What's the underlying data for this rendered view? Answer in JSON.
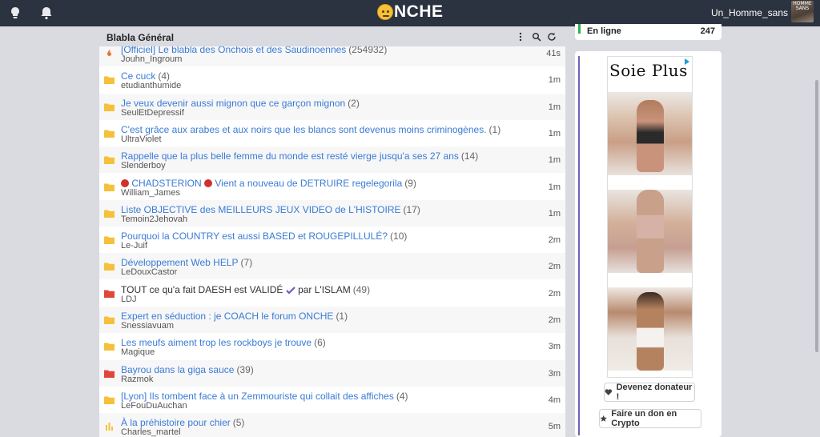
{
  "header": {
    "logo_text": "NCHE",
    "username": "Un_Homme_sans",
    "avatar_caption": "HOMME SANS",
    "icons": [
      "lightbulb-icon",
      "bell-icon"
    ]
  },
  "forum": {
    "title": "Blabla Général",
    "icons": [
      "more-vertical-icon",
      "search-icon",
      "refresh-icon"
    ]
  },
  "topics": [
    {
      "icon": "fire",
      "title": "[Officiel] Le blabla des Onchois et des Saudinoennes",
      "count": "(254932)",
      "author": "Jouhn_Ingroum",
      "time": "41s"
    },
    {
      "icon": "folder",
      "title": "Ce cuck",
      "count": "(4)",
      "author": "etudianthumide",
      "time": "1m"
    },
    {
      "icon": "folder",
      "title": "Je veux devenir aussi mignon que ce garçon mignon",
      "count": "(2)",
      "author": "SeulEtDepressif",
      "time": "1m"
    },
    {
      "icon": "folder",
      "title": "C'est grâce aux arabes et aux noirs que les blancs sont devenus moins criminogènes.",
      "count": "(1)",
      "author": "UltraViolet",
      "time": "1m"
    },
    {
      "icon": "folder",
      "title": "Rappelle que la plus belle femme du monde est resté vierge jusqu'a ses 27 ans",
      "count": "(14)",
      "author": "Slenderboy",
      "time": "1m"
    },
    {
      "icon": "folder",
      "title_prefix": "CHADSTERION",
      "title": "Vient a nouveau de DETRUIRE regelegorila",
      "count": "(9)",
      "author": "William_James",
      "time": "1m"
    },
    {
      "icon": "folder",
      "title": "Liste OBJECTIVE des MEILLEURS JEUX VIDEO de L'HISTOIRE",
      "count": "(17)",
      "author": "Temoin2Jehovah",
      "time": "1m"
    },
    {
      "icon": "folder",
      "title": "Pourquoi la COUNTRY est aussi BASED et ROUGEPILLULÉ?",
      "count": "(10)",
      "author": "Le-Juif",
      "time": "2m"
    },
    {
      "icon": "folder",
      "title": "Développement Web HELP",
      "count": "(7)",
      "author": "LeDouxCastor",
      "time": "2m"
    },
    {
      "icon": "folder-red",
      "title_prefix": "TOUT ce qu'a fait DAESH est VALIDÉ",
      "title": "par L'ISLAM",
      "count": "(49)",
      "author": "LDJ",
      "time": "2m"
    },
    {
      "icon": "folder",
      "title": "Expert en séduction : je COACH le forum ONCHE",
      "count": "(1)",
      "author": "Snessiavuam",
      "time": "2m"
    },
    {
      "icon": "folder",
      "title": "Les meufs aiment trop les rockboys je trouve",
      "count": "(6)",
      "author": "Magique",
      "time": "3m"
    },
    {
      "icon": "folder-red",
      "title": "Bayrou dans la giga sauce",
      "count": "(39)",
      "author": "Razmok",
      "time": "3m"
    },
    {
      "icon": "folder",
      "title": "[Lyon] Ils tombent face à un Zemmouriste qui collait des affiches",
      "count": "(4)",
      "author": "LeFouDuAuchan",
      "time": "4m"
    },
    {
      "icon": "poll",
      "title": "À la préhistoire pour chier",
      "count": "(5)",
      "author": "Charles_martel",
      "time": "5m"
    }
  ],
  "sidebar": {
    "online_label": "En ligne",
    "online_count": "247",
    "ad_brand": "Soie Plus",
    "donor_button": "Devenez donateur !",
    "crypto_button": "Faire un don en Crypto"
  },
  "colors": {
    "topbar": "#2b3240",
    "link": "#3a7bd5",
    "folder": "#f5c13a",
    "folder_red": "#e0473a",
    "online": "#2bb24c"
  }
}
